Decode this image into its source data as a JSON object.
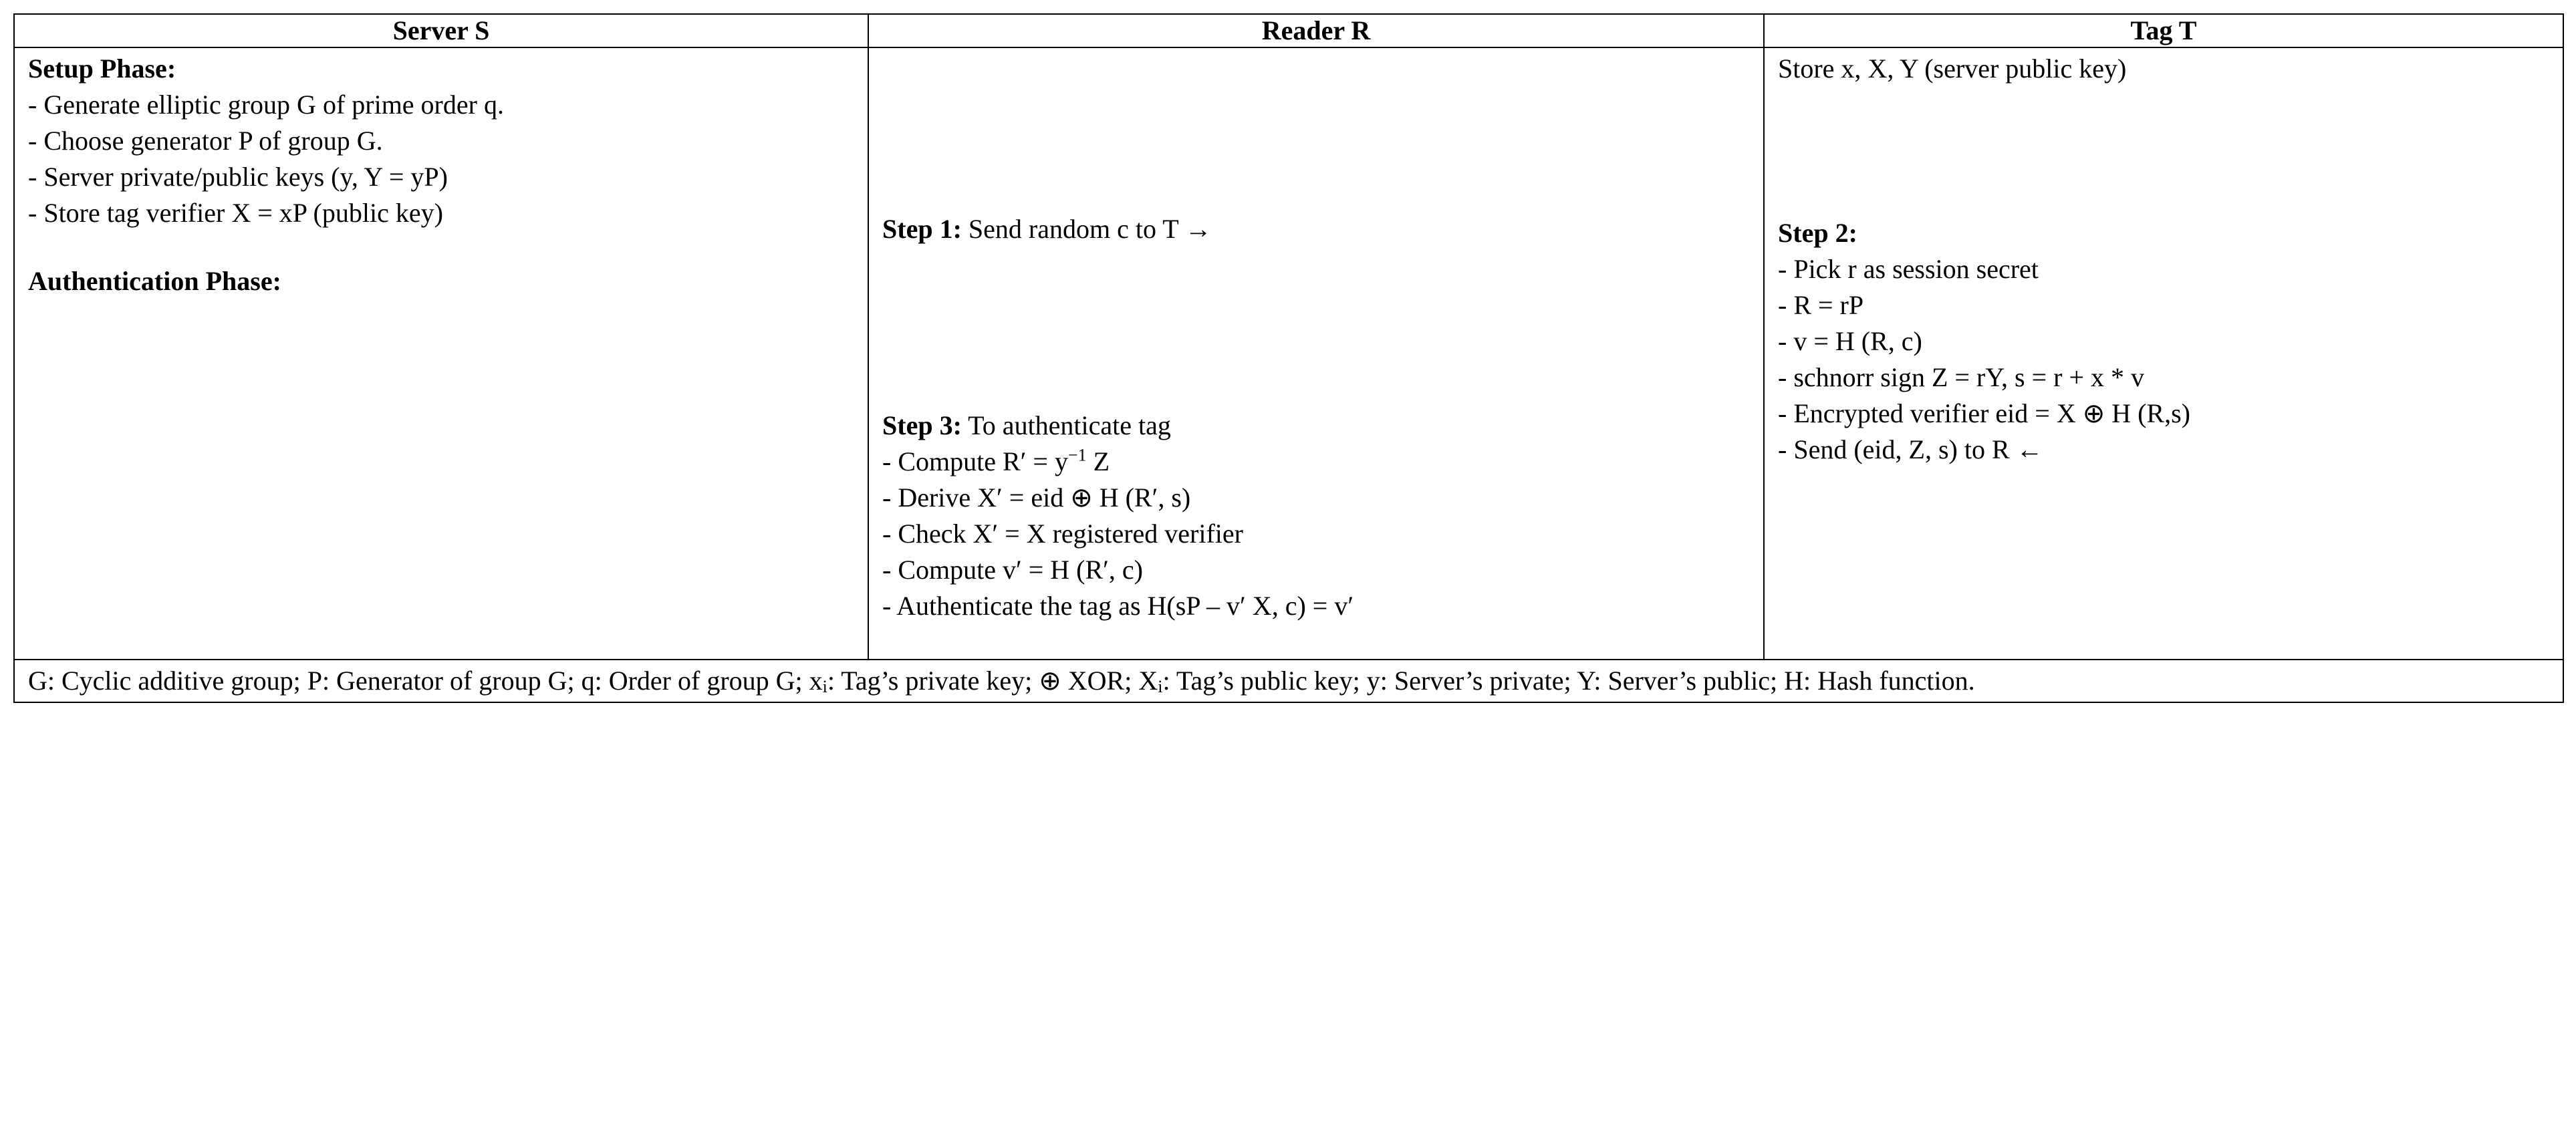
{
  "headers": {
    "server": "Server S",
    "reader": "Reader R",
    "tag": "Tag T"
  },
  "server": {
    "setup_label": "Setup Phase:",
    "setup1": "- Generate elliptic group G of prime order q.",
    "setup2": "- Choose generator P of group G.",
    "setup3": "- Server private/public keys (y, Y = yP)",
    "setup4": "- Store tag verifier X = xP (public key)",
    "auth_label": "Authentication Phase:"
  },
  "reader": {
    "step1_label": "Step 1:",
    "step1_text": " Send random c to T →",
    "step3_label": "Step 3:",
    "step3_text": " To authenticate tag",
    "s3a_pre": "- Compute R′ = y",
    "s3a_sup": "−1",
    "s3a_post": " Z",
    "s3b": "- Derive X′ = eid ⊕ H (R′, s)",
    "s3c": "- Check X′ = X registered verifier",
    "s3d": "- Compute v′ = H (R′, c)",
    "s3e": "- Authenticate the tag as H(sP – v′ X, c) = v′"
  },
  "tag": {
    "store": "Store x, X, Y (server public key)",
    "step2_label": "Step 2:",
    "s2a": "- Pick r as session secret",
    "s2b": "- R = rP",
    "s2c": "- v = H (R, c)",
    "s2d": "- schnorr sign Z = rY, s = r + x * v",
    "s2e": "- Encrypted verifier eid = X ⊕ H (R,s)",
    "s2f": "- Send (eid, Z, s) to R ←"
  },
  "footer": {
    "pre": "G: Cyclic additive group; P: Generator of group G; q: Order of group G; x",
    "sub1": "i",
    "mid1": ": Tag’s private key; ⊕ XOR; X",
    "sub2": "i",
    "mid2": ": Tag’s public key; y: Server’s private; Y: Server’s public; H: Hash function."
  }
}
